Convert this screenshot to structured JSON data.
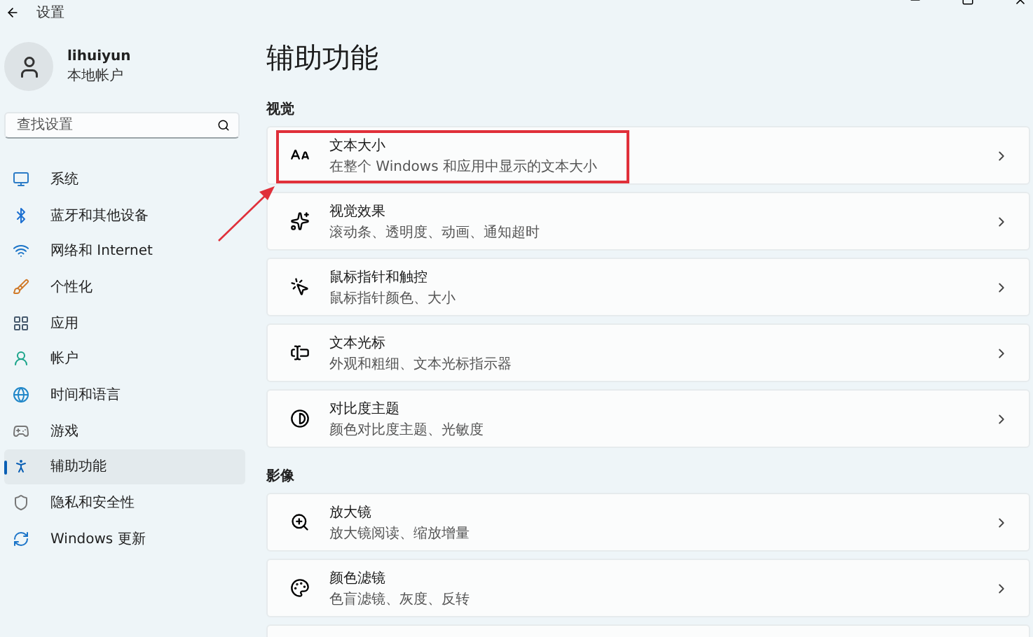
{
  "window": {
    "title": "设置"
  },
  "user": {
    "name": "lihuiyun",
    "account_type": "本地帐户"
  },
  "search": {
    "placeholder": "查找设置"
  },
  "nav": [
    {
      "label": "系统",
      "selected": false
    },
    {
      "label": "蓝牙和其他设备",
      "selected": false
    },
    {
      "label": "网络和 Internet",
      "selected": false
    },
    {
      "label": "个性化",
      "selected": false
    },
    {
      "label": "应用",
      "selected": false
    },
    {
      "label": "帐户",
      "selected": false
    },
    {
      "label": "时间和语言",
      "selected": false
    },
    {
      "label": "游戏",
      "selected": false
    },
    {
      "label": "辅助功能",
      "selected": true
    },
    {
      "label": "隐私和安全性",
      "selected": false
    },
    {
      "label": "Windows 更新",
      "selected": false
    }
  ],
  "page_title": "辅助功能",
  "sections": [
    {
      "title": "视觉",
      "items": [
        {
          "title": "文本大小",
          "subtitle": "在整个 Windows 和应用中显示的文本大小",
          "highlighted": true
        },
        {
          "title": "视觉效果",
          "subtitle": "滚动条、透明度、动画、通知超时",
          "highlighted": false
        },
        {
          "title": "鼠标指针和触控",
          "subtitle": "鼠标指针颜色、大小",
          "highlighted": false
        },
        {
          "title": "文本光标",
          "subtitle": "外观和粗细、文本光标指示器",
          "highlighted": false
        },
        {
          "title": "对比度主题",
          "subtitle": "颜色对比度主题、光敏度",
          "highlighted": false
        }
      ]
    },
    {
      "title": "影像",
      "items": [
        {
          "title": "放大镜",
          "subtitle": "放大镜阅读、缩放增量",
          "highlighted": false
        },
        {
          "title": "颜色滤镜",
          "subtitle": "色盲滤镜、灰度、反转",
          "highlighted": false
        }
      ]
    }
  ]
}
